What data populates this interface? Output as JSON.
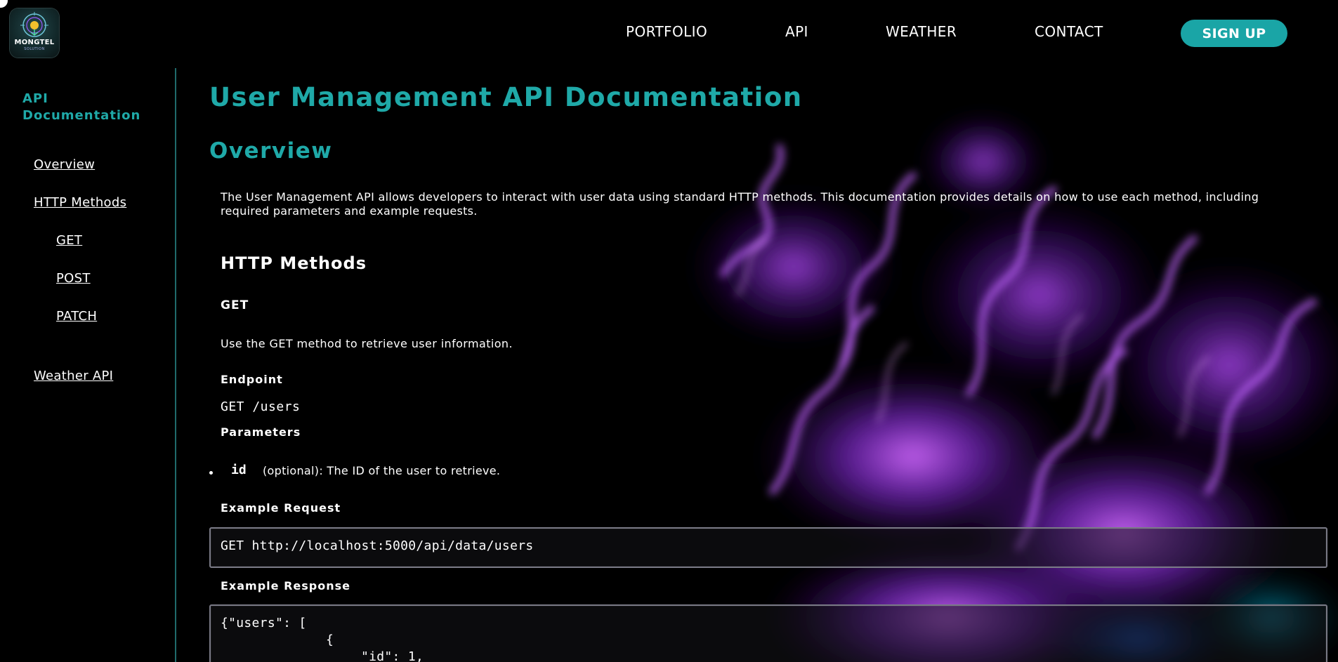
{
  "header": {
    "logo_text": "MONGTEL",
    "logo_subtext": "SOLUTION",
    "nav": [
      {
        "label": "PORTFOLIO"
      },
      {
        "label": "API"
      },
      {
        "label": "WEATHER"
      },
      {
        "label": "CONTACT"
      }
    ],
    "signup_label": "SIGN UP"
  },
  "sidebar": {
    "title": "API Documentation",
    "links": [
      {
        "label": "Overview"
      },
      {
        "label": "HTTP Methods"
      },
      {
        "label": "GET"
      },
      {
        "label": "POST"
      },
      {
        "label": "PATCH"
      },
      {
        "label": "Weather API"
      }
    ]
  },
  "main": {
    "title": "User Management API Documentation",
    "overview_heading": "Overview",
    "overview_text": "The User Management API allows developers to interact with user data using standard HTTP methods. This documentation provides details on how to use each method, including required parameters and example requests.",
    "methods_heading": "HTTP Methods",
    "get": {
      "heading": "GET",
      "description": "Use the GET method to retrieve user information.",
      "endpoint_label": "Endpoint",
      "endpoint": "GET /users",
      "parameters_label": "Parameters",
      "param_name": "id",
      "param_desc": "(optional): The ID of the user to retrieve.",
      "example_request_label": "Example Request",
      "example_request": "GET http://localhost:5000/api/data/users",
      "example_response_label": "Example Response",
      "response_lines": [
        "{\"users\": [",
        "{",
        "\"id\": 1,"
      ]
    }
  },
  "colors": {
    "accent": "#1fa9a8",
    "background": "#000000",
    "flame": "#9b30ff"
  }
}
